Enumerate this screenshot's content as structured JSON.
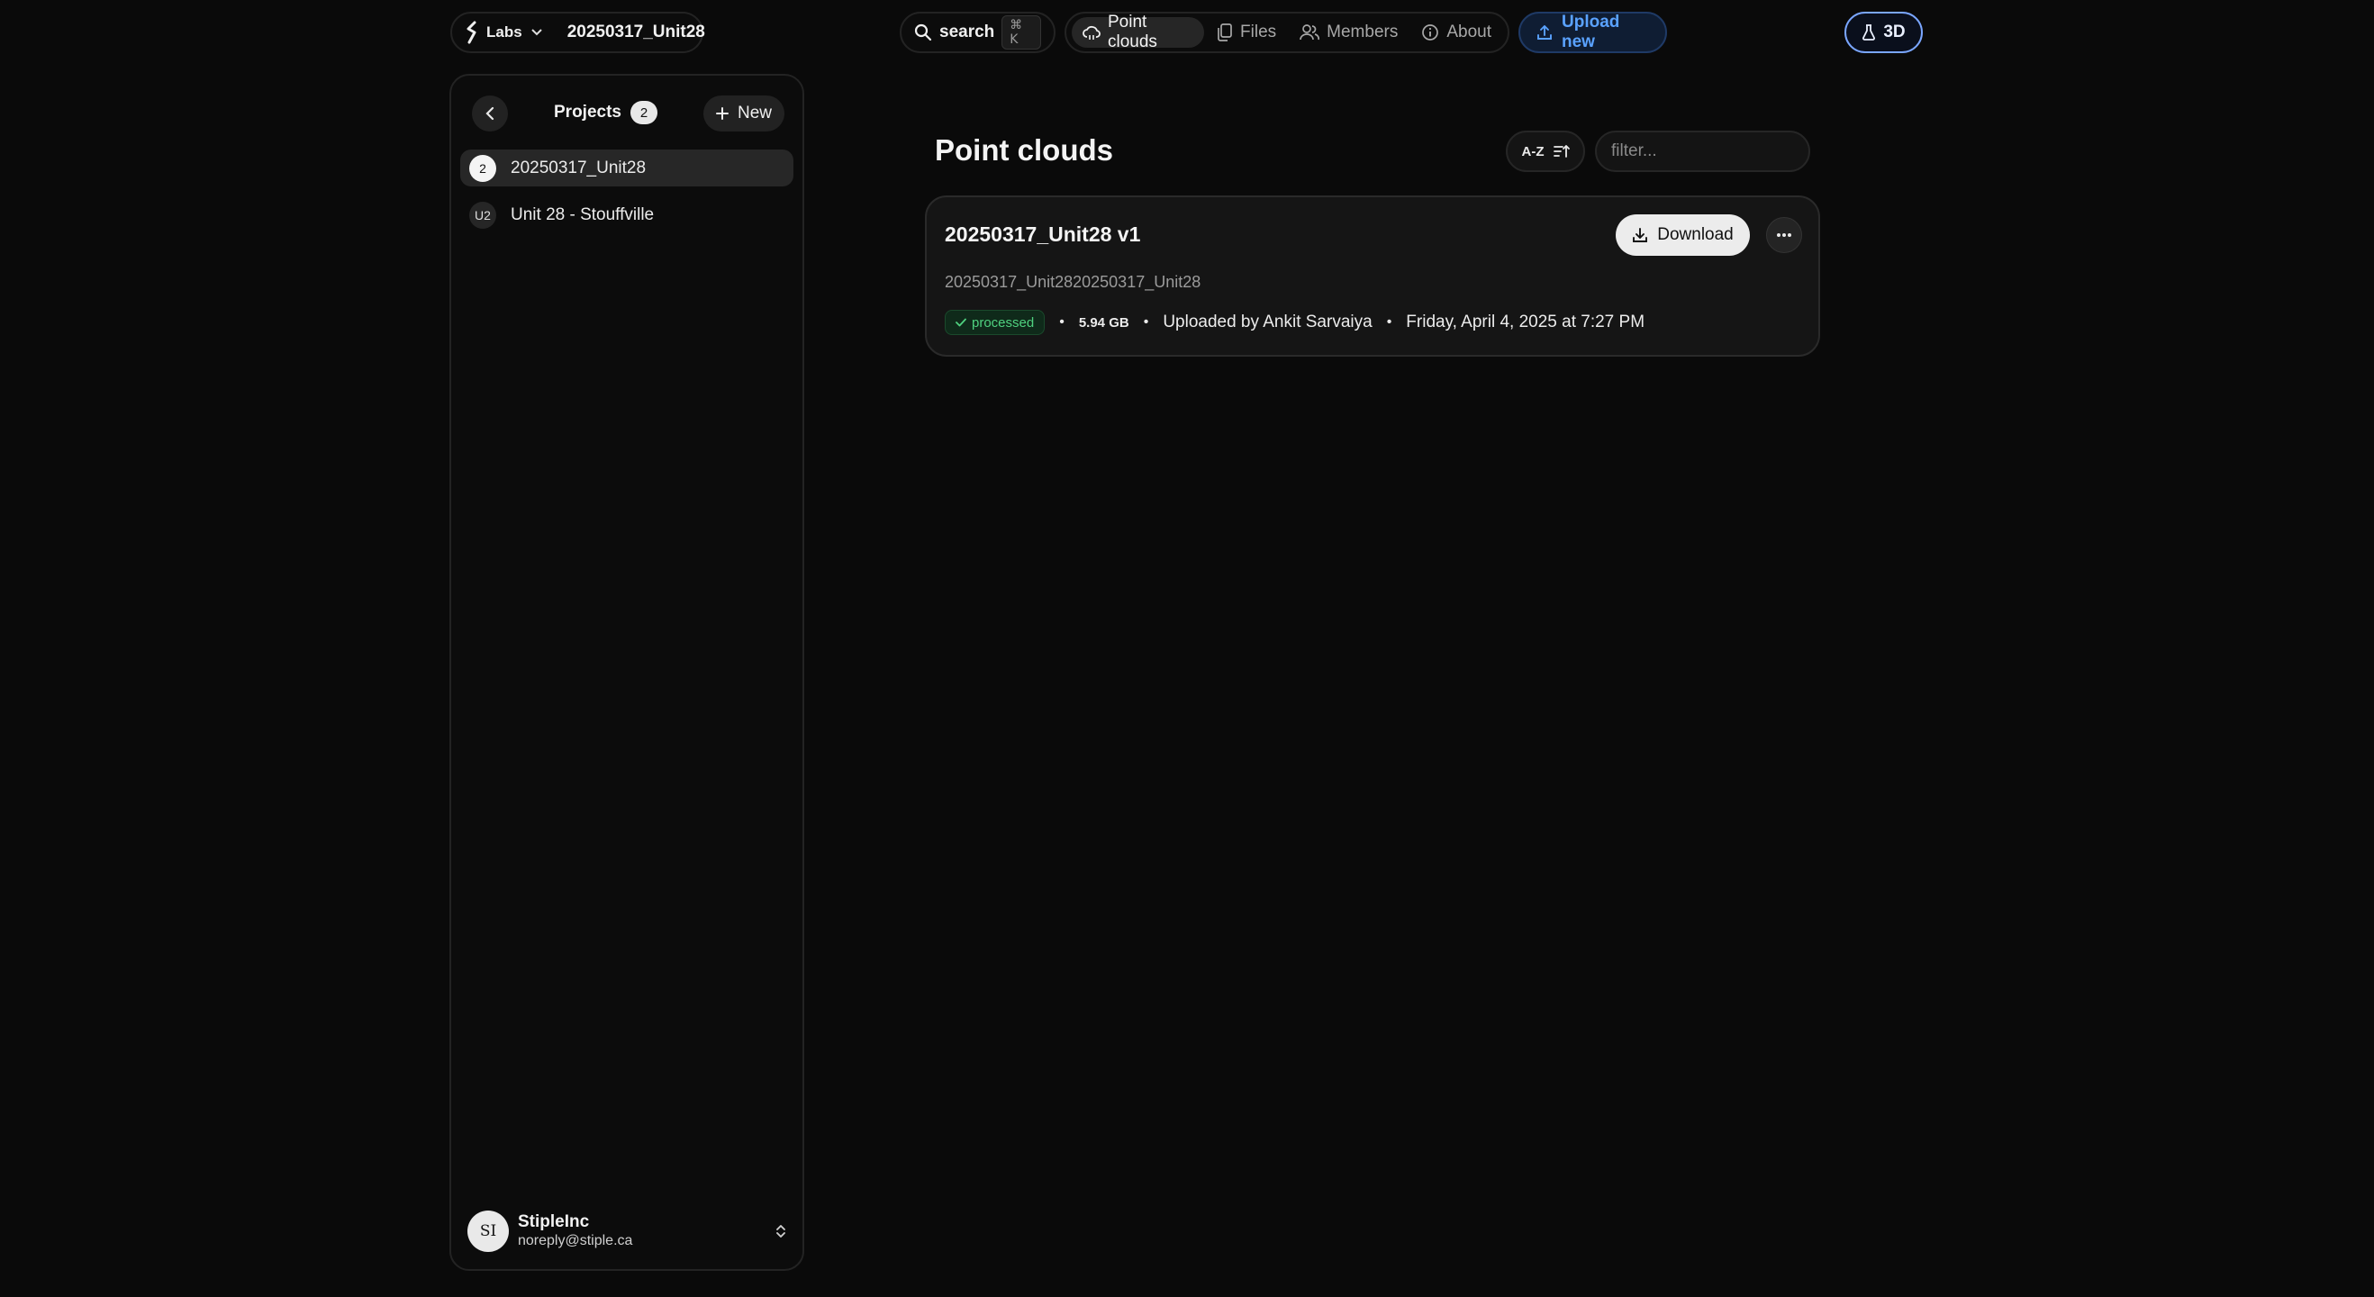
{
  "topbar": {
    "org_label": "Labs",
    "current_project": "20250317_Unit28",
    "search_label": "search",
    "search_shortcut": "⌘ K",
    "tabs": [
      {
        "label": "Point clouds",
        "icon": "cloud-icon",
        "active": true
      },
      {
        "label": "Files",
        "icon": "files-icon",
        "active": false
      },
      {
        "label": "Members",
        "icon": "members-icon",
        "active": false
      },
      {
        "label": "About",
        "icon": "info-icon",
        "active": false
      }
    ],
    "upload_label": "Upload new",
    "mode_label": "3D"
  },
  "sidebar": {
    "title": "Projects",
    "count": "2",
    "new_label": "New",
    "projects": [
      {
        "avatar": "2",
        "name": "20250317_Unit28",
        "active": true
      },
      {
        "avatar": "U2",
        "name": "Unit 28 - Stouffville",
        "active": false
      }
    ],
    "user": {
      "initials": "SI",
      "name": "StipleInc",
      "email": "noreply@stiple.ca"
    }
  },
  "main": {
    "title": "Point clouds",
    "sort_label": "A-Z",
    "filter_placeholder": "filter...",
    "items": [
      {
        "title": "20250317_Unit28 v1",
        "subtitle": "20250317_Unit2820250317_Unit28",
        "status": "processed",
        "size": "5.94 GB",
        "uploader": "Uploaded by Ankit Sarvaiya",
        "date": "Friday, April 4, 2025 at 7:27 PM",
        "download_label": "Download"
      }
    ]
  },
  "colors": {
    "background": "#0a0a0a",
    "accent": "#5aa2ff",
    "status_processed": "#4fd17f"
  }
}
